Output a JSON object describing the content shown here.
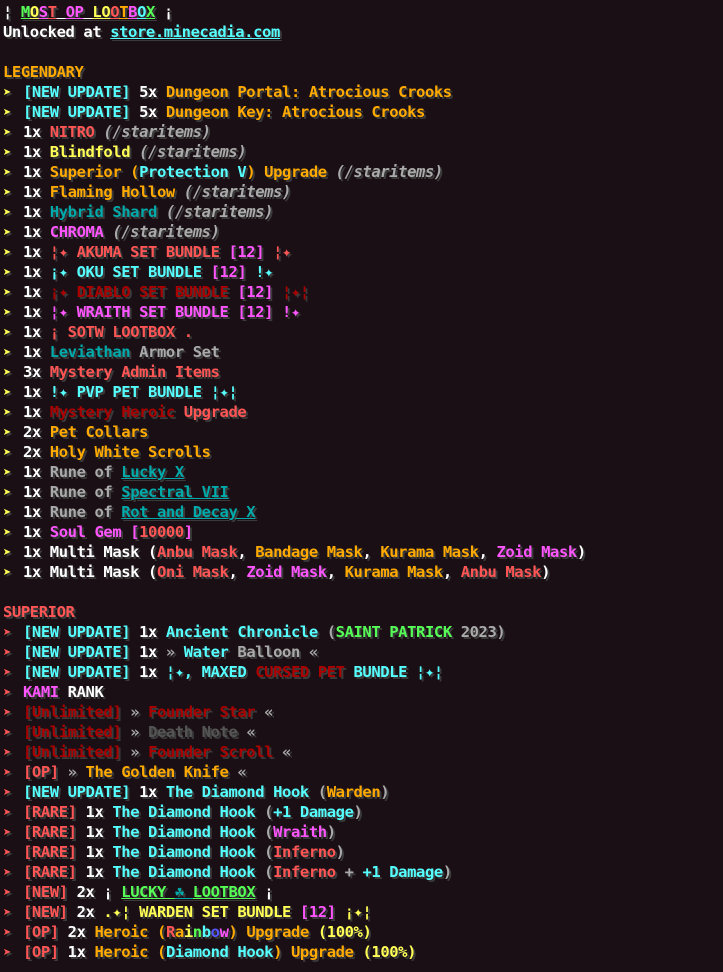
{
  "colors": {
    "white": "#ffffff",
    "gray": "#aaaaaa",
    "gold": "#ffaa00",
    "yellow": "#ffff55",
    "aqua": "#55ffff",
    "darkaqua": "#00aaaa",
    "red": "#ff5555",
    "darkred": "#aa0000",
    "pink": "#ff55ff",
    "purple": "#aa00aa",
    "green": "#55ff55",
    "darkgreen": "#00aa00"
  },
  "header": {
    "title_letters": [
      {
        "t": "M",
        "c": "#55ff55"
      },
      {
        "t": "O",
        "c": "#ffff55"
      },
      {
        "t": "S",
        "c": "#ff55ff"
      },
      {
        "t": "T",
        "c": "#ff5555"
      },
      {
        "t": " ",
        "c": "#ffffff"
      },
      {
        "t": "O",
        "c": "#ff55ff"
      },
      {
        "t": "P",
        "c": "#ff55ff"
      },
      {
        "t": " ",
        "c": "#ffffff"
      },
      {
        "t": "L",
        "c": "#ffff55"
      },
      {
        "t": "O",
        "c": "#ffff55"
      },
      {
        "t": "O",
        "c": "#ff5555"
      },
      {
        "t": "T",
        "c": "#ffaa00"
      },
      {
        "t": "B",
        "c": "#ff55ff"
      },
      {
        "t": "O",
        "c": "#55ffff"
      },
      {
        "t": "X",
        "c": "#55ff55"
      }
    ],
    "title_prefix": "¦ ",
    "title_suffix": " ¡",
    "unlocked_label": "Unlocked at ",
    "store_link": "store.minecadia.com"
  },
  "sections": [
    {
      "name": "LEGENDARY",
      "name_color": "#ffaa00",
      "arrow": "➤",
      "arrow_color": "#ffff55",
      "items": [
        [
          [
            "[NEW UPDATE] ",
            "#55ffff"
          ],
          [
            "5x ",
            "#ffffff"
          ],
          [
            "Dungeon Portal: Atrocious Crooks",
            "#ffaa00"
          ]
        ],
        [
          [
            "[NEW UPDATE] ",
            "#55ffff"
          ],
          [
            "5x ",
            "#ffffff"
          ],
          [
            "Dungeon Key: Atrocious Crooks",
            "#ffaa00"
          ]
        ],
        [
          [
            "1x ",
            "#ffffff"
          ],
          [
            "NITRO",
            "#ff5555"
          ],
          [
            " (/staritems)",
            "#aaaaaa",
            "i"
          ]
        ],
        [
          [
            "1x ",
            "#ffffff"
          ],
          [
            "Blindfold",
            "#ffff55"
          ],
          [
            " (/staritems)",
            "#aaaaaa",
            "i"
          ]
        ],
        [
          [
            "1x ",
            "#ffffff"
          ],
          [
            "Superior (",
            "#ffaa00"
          ],
          [
            "Protection V",
            "#55ffff"
          ],
          [
            ") Upgrade",
            "#ffaa00"
          ],
          [
            " (/staritems)",
            "#aaaaaa",
            "i"
          ]
        ],
        [
          [
            "1x ",
            "#ffffff"
          ],
          [
            "Flaming Hollow",
            "#ffaa00"
          ],
          [
            " (/staritems)",
            "#aaaaaa",
            "i"
          ]
        ],
        [
          [
            "1x ",
            "#ffffff"
          ],
          [
            "Hybrid Shard",
            "#00aaaa"
          ],
          [
            " (/staritems)",
            "#aaaaaa",
            "i"
          ]
        ],
        [
          [
            "1x ",
            "#ffffff"
          ],
          [
            "CHROMA",
            "#ff55ff"
          ],
          [
            " (/staritems)",
            "#aaaaaa",
            "i"
          ]
        ],
        [
          [
            "1x ",
            "#ffffff"
          ],
          [
            "¦✦ ",
            "#ff5555"
          ],
          [
            "AKUMA SET BUNDLE ",
            "#ff5555"
          ],
          [
            "[12]",
            "#ff55ff"
          ],
          [
            " ¦✦",
            "#ff5555"
          ]
        ],
        [
          [
            "1x ",
            "#ffffff"
          ],
          [
            "¡✦ ",
            "#55ffff"
          ],
          [
            "OKU SET BUNDLE ",
            "#55ffff"
          ],
          [
            "[12]",
            "#ff55ff"
          ],
          [
            " !✦",
            "#55ffff"
          ]
        ],
        [
          [
            "1x ",
            "#ffffff"
          ],
          [
            "¡✦ ",
            "#aa0000"
          ],
          [
            "DIABLO SET BUNDLE ",
            "#aa0000"
          ],
          [
            "[12]",
            "#ff55ff"
          ],
          [
            " ¦✦¦",
            "#aa0000"
          ]
        ],
        [
          [
            "1x ",
            "#ffffff"
          ],
          [
            "¦✦ ",
            "#ff55ff"
          ],
          [
            "WRAITH SET BUNDLE ",
            "#ff55ff"
          ],
          [
            "[12]",
            "#ff55ff"
          ],
          [
            " !✦",
            "#ff55ff"
          ]
        ],
        [
          [
            "1x ",
            "#ffffff"
          ],
          [
            "¡ ",
            "#ff5555"
          ],
          [
            "SOTW LOOTBOX",
            "#ff5555"
          ],
          [
            " .",
            "#ff5555"
          ]
        ],
        [
          [
            "1x ",
            "#ffffff"
          ],
          [
            "Leviathan ",
            "#00aaaa"
          ],
          [
            "Armor Set",
            "#aaaaaa"
          ]
        ],
        [
          [
            "3x ",
            "#ffffff"
          ],
          [
            "Mystery Admin Items",
            "#ff5555"
          ]
        ],
        [
          [
            "1x ",
            "#ffffff"
          ],
          [
            "!✦ ",
            "#55ffff"
          ],
          [
            "PVP PET BUNDLE",
            "#55ffff"
          ],
          [
            " ¦✦¦",
            "#55ffff"
          ]
        ],
        [
          [
            "1x ",
            "#ffffff"
          ],
          [
            "Mystery Heroic ",
            "#aa0000"
          ],
          [
            "Upgrade",
            "#ff5555"
          ]
        ],
        [
          [
            "2x ",
            "#ffffff"
          ],
          [
            "Pet Collars",
            "#ffaa00"
          ]
        ],
        [
          [
            "2x ",
            "#ffffff"
          ],
          [
            "Holy White Scrolls",
            "#ffaa00"
          ]
        ],
        [
          [
            "1x ",
            "#ffffff"
          ],
          [
            "Rune of ",
            "#aaaaaa"
          ],
          [
            "Lucky X",
            "#00aaaa",
            "u"
          ]
        ],
        [
          [
            "1x ",
            "#ffffff"
          ],
          [
            "Rune of ",
            "#aaaaaa"
          ],
          [
            "Spectral VII",
            "#00aaaa",
            "u"
          ]
        ],
        [
          [
            "1x ",
            "#ffffff"
          ],
          [
            "Rune of ",
            "#aaaaaa"
          ],
          [
            "Rot and Decay X",
            "#00aaaa",
            "u"
          ]
        ],
        [
          [
            "1x ",
            "#ffffff"
          ],
          [
            "Soul Gem ",
            "#ff55ff"
          ],
          [
            "[",
            "#ff55ff"
          ],
          [
            "10000",
            "#ff5555"
          ],
          [
            "]",
            "#ff55ff"
          ]
        ],
        [
          [
            "1x ",
            "#ffffff"
          ],
          [
            "Multi Mask (",
            "#ffffff"
          ],
          [
            "Anbu Mask",
            "#ff5555"
          ],
          [
            ", ",
            "#ffffff"
          ],
          [
            "Bandage Mask",
            "#ffaa00"
          ],
          [
            ", ",
            "#ffffff"
          ],
          [
            "Kurama Mask",
            "#ffaa00"
          ],
          [
            ", ",
            "#ffffff"
          ],
          [
            "Zoid Mask",
            "#ff55ff"
          ],
          [
            ")",
            "#ffffff"
          ]
        ],
        [
          [
            "1x ",
            "#ffffff"
          ],
          [
            "Multi Mask (",
            "#ffffff"
          ],
          [
            "Oni Mask",
            "#ff5555"
          ],
          [
            ", ",
            "#ffffff"
          ],
          [
            "Zoid Mask",
            "#ff55ff"
          ],
          [
            ", ",
            "#ffffff"
          ],
          [
            "Kurama Mask",
            "#ffaa00"
          ],
          [
            ", ",
            "#ffffff"
          ],
          [
            "Anbu Mask",
            "#ff5555"
          ],
          [
            ")",
            "#ffffff"
          ]
        ]
      ]
    },
    {
      "name": "SUPERIOR",
      "name_color": "#ff5555",
      "arrow": "➤",
      "arrow_color": "#ff5555",
      "items": [
        [
          [
            "[NEW UPDATE] ",
            "#55ffff"
          ],
          [
            "1x ",
            "#ffffff"
          ],
          [
            "Ancient Chronicle ",
            "#55ffff"
          ],
          [
            "(",
            "#aaaaaa"
          ],
          [
            "SAINT PATRICK ",
            "#55ff55"
          ],
          [
            "2023",
            "#aaaaaa"
          ],
          [
            ")",
            "#aaaaaa"
          ]
        ],
        [
          [
            "[NEW UPDATE] ",
            "#55ffff"
          ],
          [
            "1x ",
            "#ffffff"
          ],
          [
            "» ",
            "#aaaaaa"
          ],
          [
            "Water ",
            "#55ffff"
          ],
          [
            "Balloon",
            "#aaaaaa"
          ],
          [
            " «",
            "#aaaaaa"
          ]
        ],
        [
          [
            "[NEW UPDATE] ",
            "#55ffff"
          ],
          [
            "1x ",
            "#ffffff"
          ],
          [
            "¦✦, ",
            "#55ffff"
          ],
          [
            "MAXED ",
            "#55ffff"
          ],
          [
            "CURSED PET ",
            "#aa0000"
          ],
          [
            "BUNDLE ",
            "#55ffff"
          ],
          [
            "¦✦¦",
            "#55ffff"
          ]
        ],
        [
          [
            "KAMI ",
            "#ff55ff"
          ],
          [
            "RANK",
            "#ffffff"
          ]
        ],
        [
          [
            "[Unlimited] ",
            "#aa0000"
          ],
          [
            "» ",
            "#aaaaaa"
          ],
          [
            "Founder Star",
            "#aa0000"
          ],
          [
            " «",
            "#aaaaaa"
          ]
        ],
        [
          [
            "[Unlimited] ",
            "#aa0000"
          ],
          [
            "» ",
            "#aaaaaa"
          ],
          [
            " Death Note",
            "#555555"
          ],
          [
            " «",
            "#aaaaaa"
          ]
        ],
        [
          [
            "[Unlimited] ",
            "#aa0000"
          ],
          [
            "» ",
            "#aaaaaa"
          ],
          [
            "Founder Scroll",
            "#aa0000"
          ],
          [
            " «",
            "#aaaaaa"
          ]
        ],
        [
          [
            "[OP] ",
            "#ff5555"
          ],
          [
            "» ",
            "#aaaaaa"
          ],
          [
            "The Golden Knife",
            "#ffaa00"
          ],
          [
            " «",
            "#aaaaaa"
          ]
        ],
        [
          [
            "[NEW UPDATE] ",
            "#55ffff"
          ],
          [
            "1x ",
            "#ffffff"
          ],
          [
            "The Diamond Hook ",
            "#55ffff"
          ],
          [
            "(",
            "#aaaaaa"
          ],
          [
            "Warden",
            "#ffaa00"
          ],
          [
            ")",
            "#aaaaaa"
          ]
        ],
        [
          [
            "[RARE] ",
            "#ff5555"
          ],
          [
            "1x ",
            "#ffffff"
          ],
          [
            "The Diamond Hook ",
            "#55ffff"
          ],
          [
            "(",
            "#aaaaaa"
          ],
          [
            "+1 Damage",
            "#55ffff"
          ],
          [
            ")",
            "#aaaaaa"
          ]
        ],
        [
          [
            "[RARE] ",
            "#ff5555"
          ],
          [
            "1x ",
            "#ffffff"
          ],
          [
            "The Diamond Hook ",
            "#55ffff"
          ],
          [
            "(",
            "#aaaaaa"
          ],
          [
            "Wraith",
            "#ff55ff"
          ],
          [
            ")",
            "#aaaaaa"
          ]
        ],
        [
          [
            "[RARE] ",
            "#ff5555"
          ],
          [
            "1x ",
            "#ffffff"
          ],
          [
            "The Diamond Hook ",
            "#55ffff"
          ],
          [
            "(",
            "#aaaaaa"
          ],
          [
            "Inferno",
            "#ff5555"
          ],
          [
            ")",
            "#aaaaaa"
          ]
        ],
        [
          [
            "[RARE] ",
            "#ff5555"
          ],
          [
            "1x ",
            "#ffffff"
          ],
          [
            "The Diamond Hook ",
            "#55ffff"
          ],
          [
            "(",
            "#aaaaaa"
          ],
          [
            "Inferno",
            "#ff5555"
          ],
          [
            " + ",
            "#aaaaaa"
          ],
          [
            "+1 Damage",
            "#55ffff"
          ],
          [
            ")",
            "#aaaaaa"
          ]
        ],
        [
          [
            "[NEW] ",
            "#ff5555"
          ],
          [
            "2x ",
            "#ffffff"
          ],
          [
            "¡ ",
            "#ffffff"
          ],
          [
            "LUCKY ",
            "#55ff55",
            "u"
          ],
          [
            "☘ ",
            "#00aaaa",
            "u"
          ],
          [
            "LOOTBOX",
            "#55ff55",
            "u"
          ],
          [
            " ¡",
            "#ffffff"
          ]
        ],
        [
          [
            "[NEW] ",
            "#ff5555"
          ],
          [
            "2x ",
            "#ffffff"
          ],
          [
            ".✦¦ ",
            "#ffff55"
          ],
          [
            "WARDEN SET BUNDLE ",
            "#ffff55"
          ],
          [
            "[12]",
            "#ff55ff"
          ],
          [
            " ¡✦¦",
            "#ffff55"
          ]
        ],
        [
          [
            "[OP] ",
            "#ff5555"
          ],
          [
            "2x ",
            "#ffffff"
          ],
          [
            "Heroic (",
            "#ffaa00"
          ],
          [
            "R",
            "#ff5555"
          ],
          [
            "a",
            "#ffaa00"
          ],
          [
            "i",
            "#ffff55"
          ],
          [
            "n",
            "#55ff55"
          ],
          [
            "b",
            "#55ffff"
          ],
          [
            "o",
            "#5555ff"
          ],
          [
            "w",
            "#ff55ff"
          ],
          [
            ") Upgrade ",
            "#ffaa00"
          ],
          [
            "(100%)",
            "#ffff55"
          ]
        ],
        [
          [
            "[OP] ",
            "#ff5555"
          ],
          [
            "1x ",
            "#ffffff"
          ],
          [
            "Heroic (",
            "#ffaa00"
          ],
          [
            "Diamond Hook",
            "#55ffff"
          ],
          [
            ") Upgrade ",
            "#ffaa00"
          ],
          [
            "(100%)",
            "#ffff55"
          ]
        ]
      ]
    }
  ]
}
